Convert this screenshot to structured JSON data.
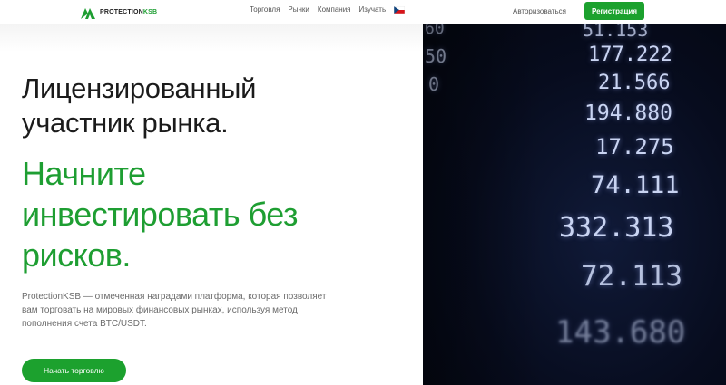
{
  "header": {
    "logo": {
      "text_main": "PROTECTION",
      "text_accent": "KSB",
      "icon": "logo-mark-icon"
    },
    "nav": [
      {
        "label": "Торговля"
      },
      {
        "label": "Рынки"
      },
      {
        "label": "Компания"
      },
      {
        "label": "Изучать"
      }
    ],
    "language_flag": "czech-flag-icon",
    "login_label": "Авторизоваться",
    "register_label": "Регистрация"
  },
  "hero": {
    "title_line1": "Лицензированный",
    "title_line2": "участник рынка.",
    "accent_line1": "Начните",
    "accent_line2": "инвестировать без",
    "accent_line3": "рисков.",
    "description": "ProtectionKSB — отмеченная наградами платформа, которая позволяет вам торговать на мировых финансовых рынках, используя метод пополнения счета BTC/USDT.",
    "cta_label": "Начать торговлю"
  },
  "ticker_image": {
    "numbers": [
      "51.153",
      "177.222",
      "21.566",
      "194.880",
      "17.275",
      "74.111",
      "332.313",
      "72.113",
      "143.680"
    ],
    "left_fragments": [
      "60",
      "50",
      "0"
    ]
  },
  "colors": {
    "accent": "#1ca12e",
    "dark_bg": "#070c1e"
  }
}
